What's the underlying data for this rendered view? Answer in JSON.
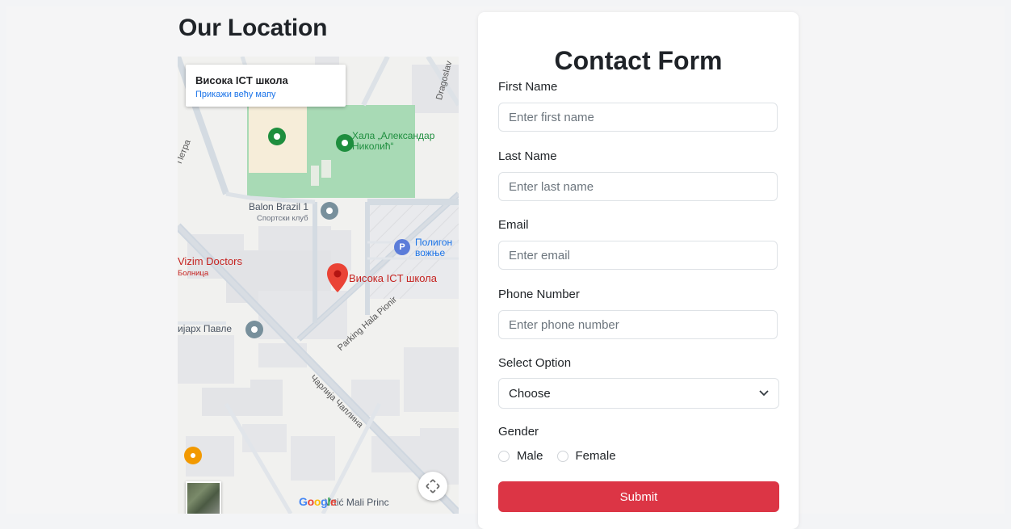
{
  "location": {
    "title": "Our Location",
    "map": {
      "place_name": "Висока ICT школа",
      "larger_map_link": "Прикажи већу мапу",
      "labels": {
        "hall": "Хала „Александар Николић“",
        "hall_line1": "Хала „Александар",
        "hall_line2": "Николић“",
        "balon": "Balon Brazil 1",
        "balon_sub": "Спортски клуб",
        "poligon_line1": "Полигон",
        "poligon_line2": "вожње",
        "vizim": "Vizim Doctors",
        "vizim_sub": "Болница",
        "school_pin": "Висока ICT школа",
        "patrijarh": "ијарх Павле",
        "parking_road": "Parking Hala Pionir",
        "chaplin_road": "Чарлија Чаплина",
        "petra_road": "Петра",
        "dragoslav_road": "Dragoslav",
        "vrtic": "Vrtić Mali Princ",
        "google": "Google"
      },
      "colors": {
        "park": "#a8dab5",
        "pin_red": "#ea4335",
        "pin_green": "#1e8e3e",
        "pin_gray": "#78909c",
        "pin_blue": "#4285f4",
        "pin_orange": "#f29900"
      }
    }
  },
  "form": {
    "title": "Contact Form",
    "first_name": {
      "label": "First Name",
      "placeholder": "Enter first name",
      "value": ""
    },
    "last_name": {
      "label": "Last Name",
      "placeholder": "Enter last name",
      "value": ""
    },
    "email": {
      "label": "Email",
      "placeholder": "Enter email",
      "value": ""
    },
    "phone": {
      "label": "Phone Number",
      "placeholder": "Enter phone number",
      "value": ""
    },
    "select": {
      "label": "Select Option",
      "selected": "Choose"
    },
    "gender": {
      "label": "Gender",
      "options": [
        "Male",
        "Female"
      ]
    },
    "submit_label": "Submit",
    "colors": {
      "submit": "#dc3545"
    }
  }
}
